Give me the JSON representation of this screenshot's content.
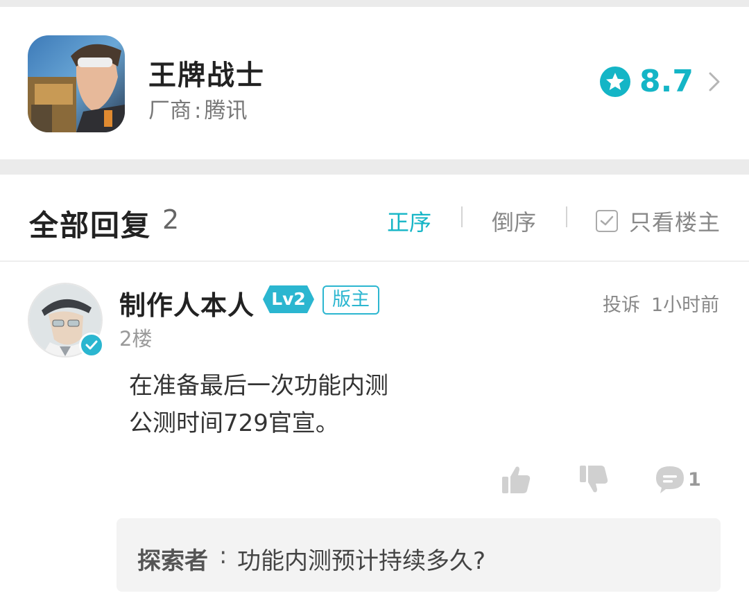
{
  "game": {
    "title": "王牌战士",
    "vendor_label": "厂商",
    "vendor_sep": ":",
    "vendor_name": "腾讯",
    "rating": "8.7",
    "icon": "game-character-icon",
    "rating_icon": "star-badge-icon"
  },
  "replies": {
    "title": "全部回复",
    "count": "2",
    "sort_asc": "正序",
    "sort_desc": "倒序",
    "op_only": "只看楼主",
    "active_color": "#14b5c6"
  },
  "post": {
    "username": "制作人本人",
    "level": "Lv2",
    "role": "版主",
    "report": "投诉",
    "time": "1小时前",
    "floor": "2楼",
    "lines": [
      "在准备最后一次功能内测",
      "公测时间729官宣。"
    ],
    "comment_count": "1",
    "sub_reply": {
      "author": "探索者",
      "colon": ":",
      "text": "功能内测预计持续多久?"
    }
  }
}
